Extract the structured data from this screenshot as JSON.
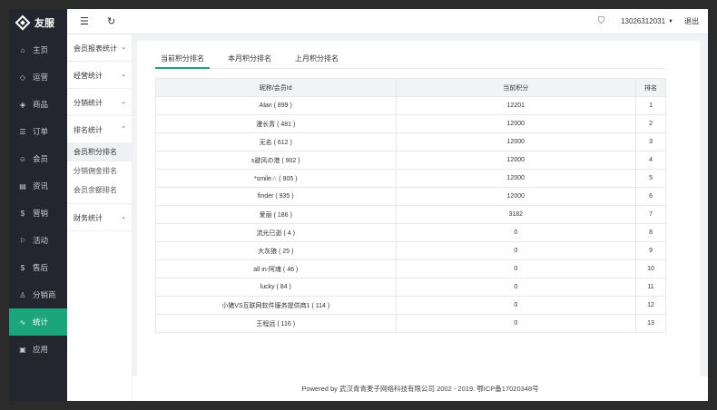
{
  "brand": {
    "name": "友服"
  },
  "sidebar": {
    "items": [
      {
        "label": "主页",
        "icon": "⌂"
      },
      {
        "label": "运营",
        "icon": "◇"
      },
      {
        "label": "商品",
        "icon": "◈"
      },
      {
        "label": "订单",
        "icon": "☰"
      },
      {
        "label": "会员",
        "icon": "☺"
      },
      {
        "label": "资讯",
        "icon": "▤"
      },
      {
        "label": "营销",
        "icon": "$"
      },
      {
        "label": "活动",
        "icon": "⚐"
      },
      {
        "label": "售后",
        "icon": "$"
      },
      {
        "label": "分销商",
        "icon": "♙"
      },
      {
        "label": "统计",
        "icon": "∿"
      },
      {
        "label": "应用",
        "icon": "▣"
      }
    ]
  },
  "topbar": {
    "menu_icon": "☰",
    "refresh_icon": "↻",
    "shirt_icon": "⛉",
    "user": "13026312031",
    "caret": "▼",
    "logout": "退出"
  },
  "subnav": {
    "groups": {
      "g1": "会员报表统计",
      "g2": "经营统计",
      "g3": "分销统计",
      "g4": "排名统计",
      "g5": "财务统计"
    },
    "chev": "⌄",
    "items": {
      "i1": "会员积分排名",
      "i2": "分销佣金排名",
      "i3": "会员余额排名"
    }
  },
  "tabs": [
    "当前积分排名",
    "本月积分排名",
    "上月积分排名"
  ],
  "table": {
    "headers": [
      "昵称/会员Id",
      "当前积分",
      "排名"
    ],
    "rows": [
      [
        "Alan ( 899 )",
        "12201",
        "1"
      ],
      [
        "漫长青 ( 481 )",
        "12000",
        "2"
      ],
      [
        "无名 ( 612 )",
        "12000",
        "3"
      ],
      [
        "s避风の港 ( 902 )",
        "12000",
        "4"
      ],
      [
        "*smile☆ ( 905 )",
        "12000",
        "5"
      ],
      [
        "finder ( 935 )",
        "12000",
        "6"
      ],
      [
        "爱丽 ( 186 )",
        "3182",
        "7"
      ],
      [
        "流光已逝 ( 4 )",
        "0",
        "8"
      ],
      [
        "大灰狼 ( 25 )",
        "0",
        "9"
      ],
      [
        "all in-阿魂 ( 46 )",
        "0",
        "10"
      ],
      [
        "lucky ( 84 )",
        "0",
        "11"
      ],
      [
        "小猪VS互联网软件服务提供商1 ( 114 )",
        "0",
        "12"
      ],
      [
        "王程远 ( 116 )",
        "0",
        "13"
      ]
    ]
  },
  "footer": "Powered by 武汉青青麦子网络科技有限公司 2002 - 2019. 鄂ICP备17020348号",
  "colors": {
    "accent": "#1aa57a",
    "sidebar_bg": "#23262e"
  }
}
